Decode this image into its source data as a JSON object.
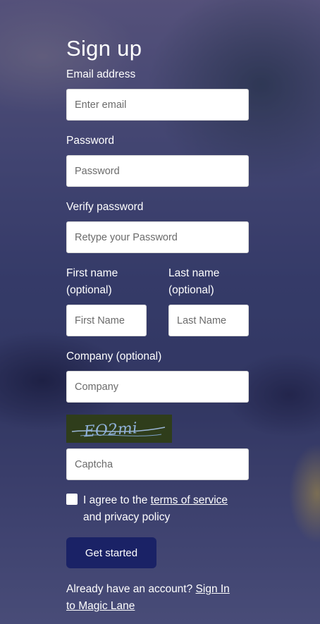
{
  "title": "Sign up",
  "fields": {
    "email": {
      "label": "Email address",
      "placeholder": "Enter email"
    },
    "password": {
      "label": "Password",
      "placeholder": "Password"
    },
    "verify": {
      "label": "Verify password",
      "placeholder": "Retype your Password"
    },
    "first_name": {
      "label_line1": "First name",
      "label_line2": "(optional)",
      "placeholder": "First Name"
    },
    "last_name": {
      "label_line1": "Last name",
      "label_line2": "(optional)",
      "placeholder": "Last Name"
    },
    "company": {
      "label": "Company (optional)",
      "placeholder": "Company"
    },
    "captcha": {
      "image_text": "EO2mi",
      "placeholder": "Captcha"
    }
  },
  "terms": {
    "prefix": "I agree to the",
    "link": "terms of service",
    "suffix": "and privacy policy"
  },
  "submit_label": "Get started",
  "footer": {
    "prefix": "Already have an account?",
    "link_part1": "Sign In",
    "link_part2": "to Magic Lane"
  },
  "colors": {
    "button": "#1a2266",
    "overlay": "#3c4366"
  }
}
